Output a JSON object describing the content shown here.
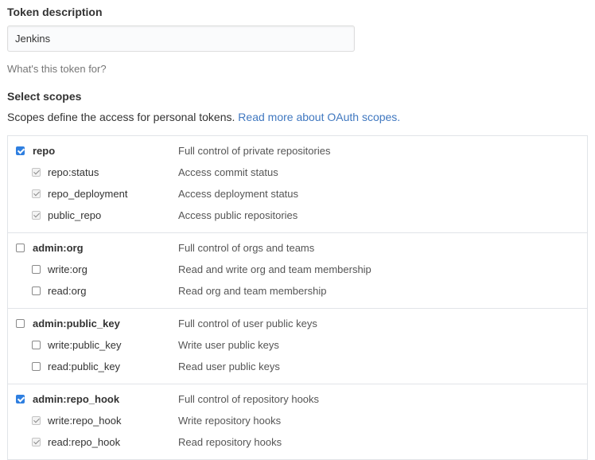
{
  "token": {
    "label": "Token description",
    "value": "Jenkins",
    "hint": "What's this token for?"
  },
  "scopes": {
    "label": "Select scopes",
    "description": "Scopes define the access for personal tokens.",
    "link_text": "Read more about OAuth scopes."
  },
  "groups": [
    {
      "parent": {
        "name": "repo",
        "desc": "Full control of private repositories",
        "checked": true
      },
      "children": [
        {
          "name": "repo:status",
          "desc": "Access commit status",
          "state": "inherited"
        },
        {
          "name": "repo_deployment",
          "desc": "Access deployment status",
          "state": "inherited"
        },
        {
          "name": "public_repo",
          "desc": "Access public repositories",
          "state": "inherited"
        }
      ]
    },
    {
      "parent": {
        "name": "admin:org",
        "desc": "Full control of orgs and teams",
        "checked": false
      },
      "children": [
        {
          "name": "write:org",
          "desc": "Read and write org and team membership",
          "state": "unchecked"
        },
        {
          "name": "read:org",
          "desc": "Read org and team membership",
          "state": "unchecked"
        }
      ]
    },
    {
      "parent": {
        "name": "admin:public_key",
        "desc": "Full control of user public keys",
        "checked": false
      },
      "children": [
        {
          "name": "write:public_key",
          "desc": "Write user public keys",
          "state": "unchecked"
        },
        {
          "name": "read:public_key",
          "desc": "Read user public keys",
          "state": "unchecked"
        }
      ]
    },
    {
      "parent": {
        "name": "admin:repo_hook",
        "desc": "Full control of repository hooks",
        "checked": true
      },
      "children": [
        {
          "name": "write:repo_hook",
          "desc": "Write repository hooks",
          "state": "inherited"
        },
        {
          "name": "read:repo_hook",
          "desc": "Read repository hooks",
          "state": "inherited"
        }
      ]
    }
  ],
  "colors": {
    "link": "#4078c0",
    "checkbox_checked": "#2f7fe0",
    "border": "#e1e4e8"
  }
}
